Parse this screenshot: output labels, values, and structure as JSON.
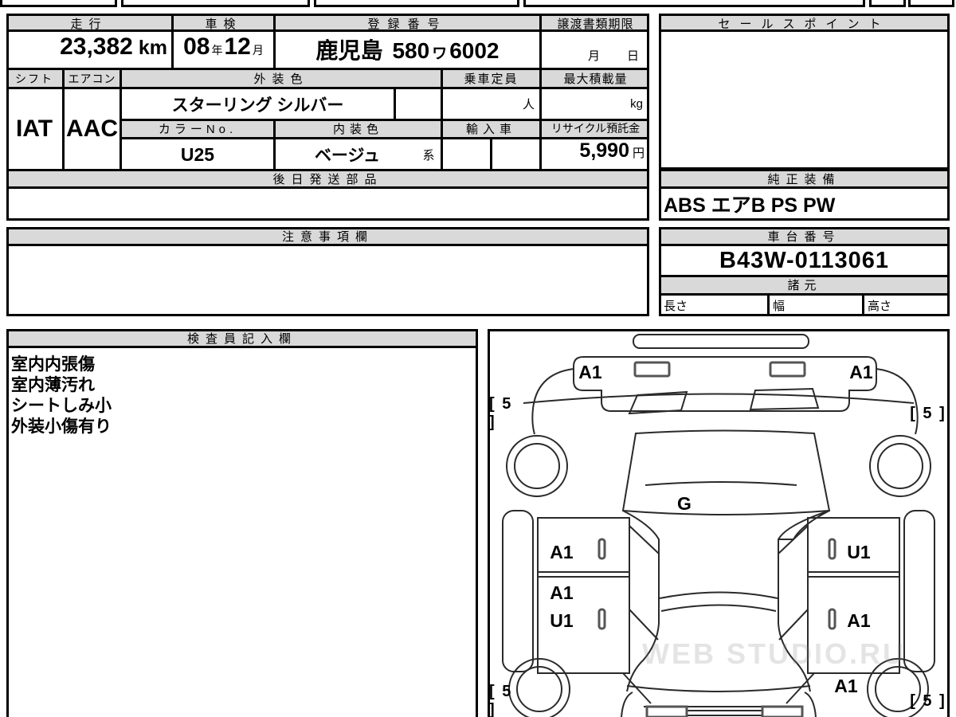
{
  "colors": {
    "header_fill": "#d9d9d9",
    "border": "#000000"
  },
  "top_section": {
    "mileage": {
      "label": "走行",
      "value": "23,382",
      "unit": "km"
    },
    "shaken": {
      "label": "車検",
      "year": "08",
      "year_unit": "年",
      "month": "12",
      "month_unit": "月"
    },
    "registration": {
      "label": "登録番号",
      "prefecture": "鹿児島",
      "class_no": "580",
      "kana": "ワ",
      "number": "6002"
    },
    "transfer_docs": {
      "label": "譲渡書類期限",
      "month_unit": "月",
      "day_unit": "日"
    },
    "sales_point": {
      "label": "セールスポイント",
      "value": ""
    }
  },
  "middle_section": {
    "shift": {
      "label": "シフト",
      "value": "IAT"
    },
    "aircon": {
      "label": "エアコン",
      "value": "AAC"
    },
    "exterior_color": {
      "label": "外装色",
      "value": "スターリング シルバー"
    },
    "capacity": {
      "label": "乗車定員",
      "unit": "人"
    },
    "max_load": {
      "label": "最大積載量",
      "unit": "kg"
    },
    "color_no": {
      "label": "カラーNo.",
      "value": "U25"
    },
    "interior_color": {
      "label": "内装色",
      "value": "ベージュ",
      "suffix": "系"
    },
    "imported": {
      "label": "輸入車",
      "value": ""
    },
    "recycle_fee": {
      "label": "リサイクル預託金",
      "value": "5,990",
      "unit": "円"
    },
    "later_parts": {
      "label": "後日発送部品",
      "value": ""
    },
    "genuine_equipment": {
      "label": "純正装備",
      "value": "ABS エアB PS PW"
    }
  },
  "notes_section": {
    "cautions": {
      "label": "注意事項欄",
      "value": ""
    },
    "chassis": {
      "label": "車台番号",
      "value": "B43W-0113061"
    },
    "specs": {
      "label": "諸元",
      "length_label": "長さ",
      "width_label": "幅",
      "height_label": "高さ"
    }
  },
  "inspector": {
    "label": "検査員記入欄",
    "lines": [
      "室内内張傷",
      "室内薄汚れ",
      "シートしみ小",
      "外装小傷有り"
    ]
  },
  "diagram": {
    "marks": {
      "front_left": "A1",
      "front_right": "A1",
      "glass": "G",
      "left_front_door": "A1",
      "left_rear_door_upper": "A1",
      "left_rear_door_lower": "U1",
      "right_front_door": "U1",
      "right_rear_door": "A1",
      "right_rear_quarter": "A1"
    },
    "tires": {
      "front_left": "[ 5 ]",
      "front_right": "[ 5 ]",
      "rear_left": "[ 5 ]",
      "rear_right": "[ 5 ]"
    },
    "watermark": "WEB STUDIO.RU"
  }
}
